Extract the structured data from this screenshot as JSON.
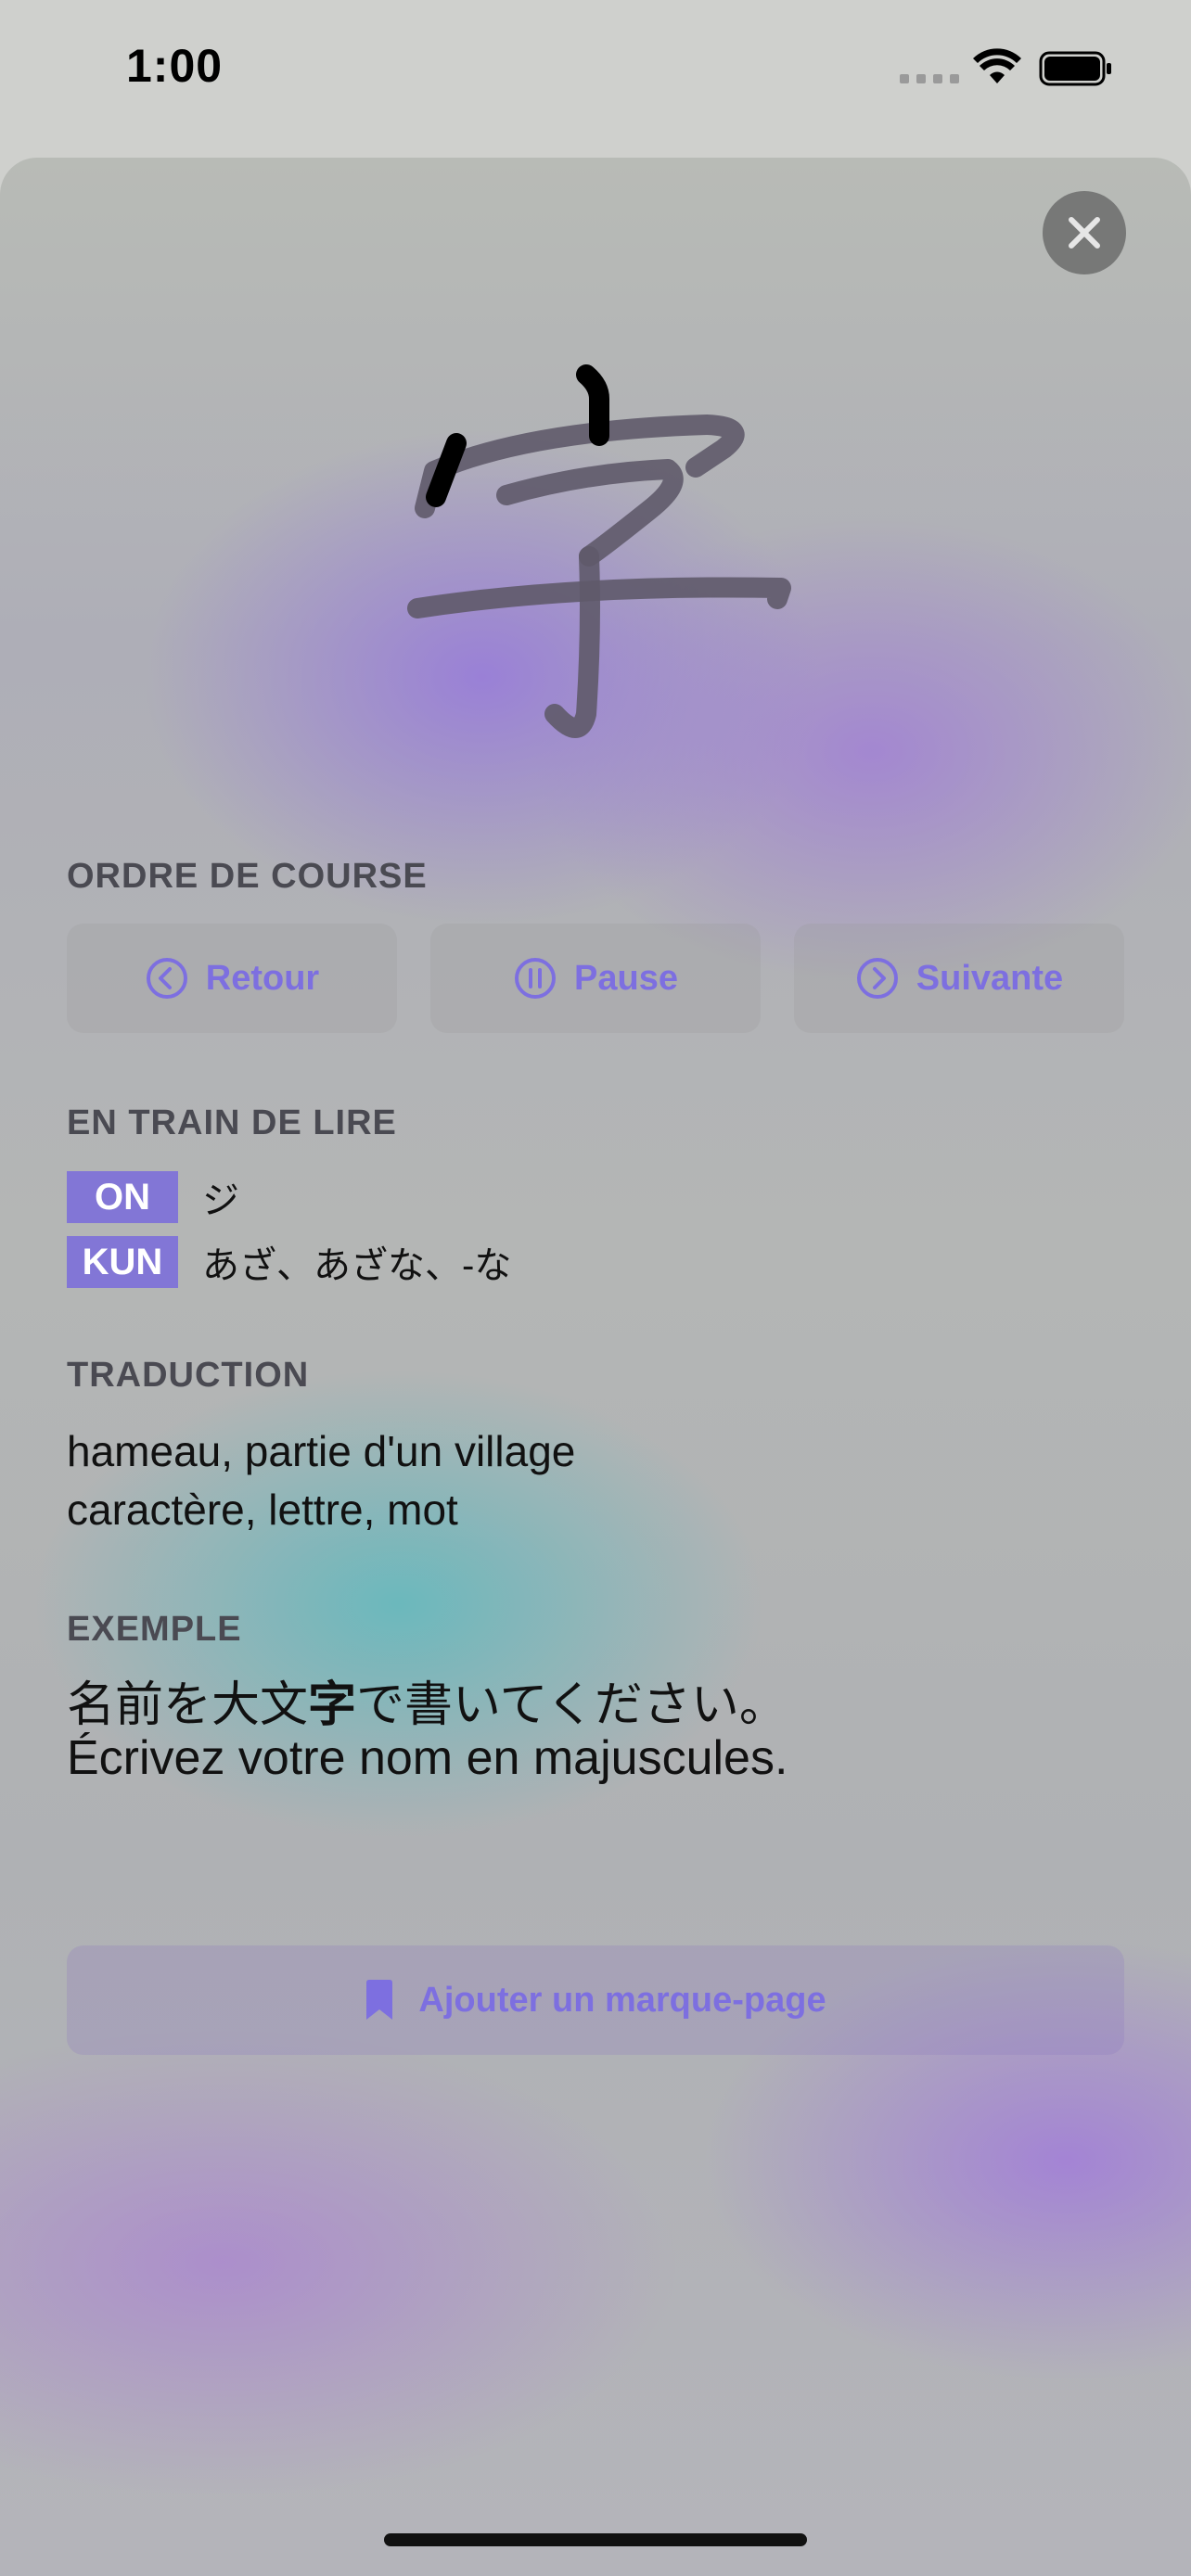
{
  "status_bar": {
    "time": "1:00",
    "icons": [
      "cellular-signal-icon",
      "wifi-icon",
      "battery-icon"
    ]
  },
  "close_button": {
    "icon": "close-icon"
  },
  "kanji": {
    "character": "字",
    "stroke_color": "#5f5a6a",
    "highlight_stroke_color": "#000000"
  },
  "stroke_order": {
    "title": "ORDRE DE COURSE",
    "back_label": "Retour",
    "pause_label": "Pause",
    "next_label": "Suivante",
    "icons": {
      "back": "chevron-left-circle-icon",
      "pause": "pause-circle-icon",
      "next": "chevron-right-circle-icon"
    }
  },
  "readings": {
    "title": "EN TRAIN DE LIRE",
    "on": {
      "label": "ON",
      "value": "ジ"
    },
    "kun": {
      "label": "KUN",
      "value": "あざ、あざな、-な"
    }
  },
  "translation": {
    "title": "TRADUCTION",
    "lines": [
      "hameau, partie d'un village",
      "caractère, lettre, mot"
    ]
  },
  "example": {
    "title": "EXEMPLE",
    "jp_before": "名前を大文",
    "jp_highlight": "字",
    "jp_after": "で書いてください。",
    "fr": "Écrivez votre nom en majuscules."
  },
  "bookmark": {
    "label": "Ajouter un marque-page",
    "icon": "bookmark-icon"
  },
  "colors": {
    "accent": "#7d6fe0",
    "badge": "#8276d6",
    "section_label": "#4a4a52"
  }
}
